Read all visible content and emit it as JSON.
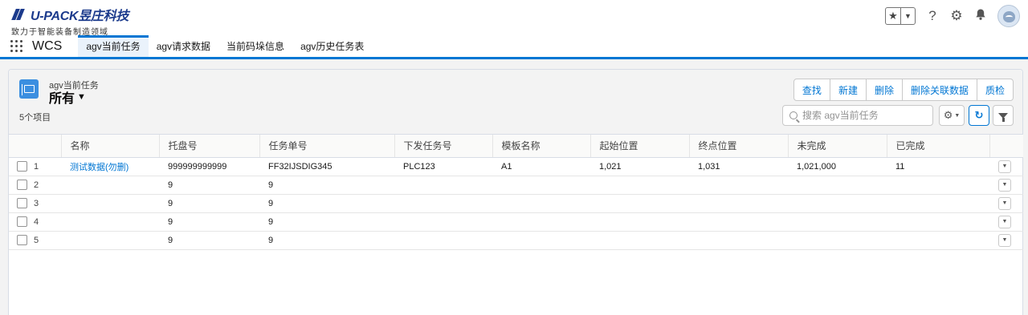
{
  "brand": {
    "name": "U-PACK昱庄科技",
    "slogan": "致力于智能装备制造领域",
    "color": "#1b3a8c"
  },
  "header": {
    "icons": [
      "star-icon",
      "chevron-down-icon",
      "help-icon",
      "settings-icon",
      "bell-icon",
      "avatar"
    ],
    "help_glyph": "?",
    "accent": "#0176d3"
  },
  "nav": {
    "app_name": "WCS",
    "tabs": [
      {
        "label": "agv当前任务",
        "active": true
      },
      {
        "label": "agv请求数据",
        "active": false
      },
      {
        "label": "当前码垛信息",
        "active": false
      },
      {
        "label": "agv历史任务表",
        "active": false
      }
    ]
  },
  "list": {
    "object_label": "agv当前任务",
    "view_name": "所有",
    "item_count": "5个项目",
    "actions": [
      "查找",
      "新建",
      "删除",
      "删除关联数据",
      "质检"
    ],
    "search_placeholder": "搜索 agv当前任务"
  },
  "table": {
    "columns": [
      "名称",
      "托盘号",
      "任务单号",
      "下发任务号",
      "模板名称",
      "起始位置",
      "终点位置",
      "未完成",
      "已完成"
    ],
    "rows": [
      {
        "num": "1",
        "name": "测试数据(勿删)",
        "pallet": "999999999999",
        "task_no": "FF32IJSDIG345",
        "issue_no": "PLC123",
        "template": "A1",
        "start": "1,021",
        "end": "1,031",
        "incomplete": "1,021,000",
        "completed": "11"
      },
      {
        "num": "2",
        "name": "",
        "pallet": "9",
        "task_no": "9",
        "issue_no": "",
        "template": "",
        "start": "",
        "end": "",
        "incomplete": "",
        "completed": ""
      },
      {
        "num": "3",
        "name": "",
        "pallet": "9",
        "task_no": "9",
        "issue_no": "",
        "template": "",
        "start": "",
        "end": "",
        "incomplete": "",
        "completed": ""
      },
      {
        "num": "4",
        "name": "",
        "pallet": "9",
        "task_no": "9",
        "issue_no": "",
        "template": "",
        "start": "",
        "end": "",
        "incomplete": "",
        "completed": ""
      },
      {
        "num": "5",
        "name": "",
        "pallet": "9",
        "task_no": "9",
        "issue_no": "",
        "template": "",
        "start": "",
        "end": "",
        "incomplete": "",
        "completed": ""
      }
    ]
  }
}
